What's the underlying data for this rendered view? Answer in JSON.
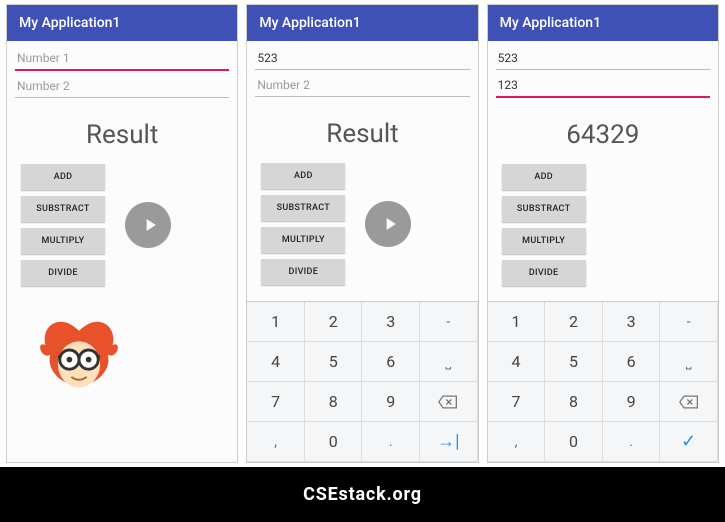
{
  "footer": {
    "text": "CSEstack.org"
  },
  "app": {
    "title": "My Application1"
  },
  "buttons": {
    "add": "ADD",
    "sub": "SUBSTRACT",
    "mul": "MULTIPLY",
    "div": "DIVIDE"
  },
  "inputs": {
    "placeholder1": "Number 1",
    "placeholder2": "Number 2"
  },
  "screens": [
    {
      "num1": "",
      "num2": "",
      "result": "Result",
      "num1_focused": true,
      "num2_focused": false,
      "show_play": true,
      "show_keyboard": false
    },
    {
      "num1": "523",
      "num2": "",
      "result": "Result",
      "num1_focused": false,
      "num2_focused": false,
      "show_play": true,
      "show_keyboard": true
    },
    {
      "num1": "523",
      "num2": "123",
      "result": "64329",
      "num1_focused": false,
      "num2_focused": true,
      "show_play": false,
      "show_keyboard": true
    }
  ],
  "keyboard": {
    "rows": [
      [
        "1",
        "2",
        "3",
        "-"
      ],
      [
        "4",
        "5",
        "6",
        "␣"
      ],
      [
        "7",
        "8",
        "9",
        "⌫"
      ],
      [
        ",",
        "0",
        ".",
        "↵"
      ]
    ]
  }
}
